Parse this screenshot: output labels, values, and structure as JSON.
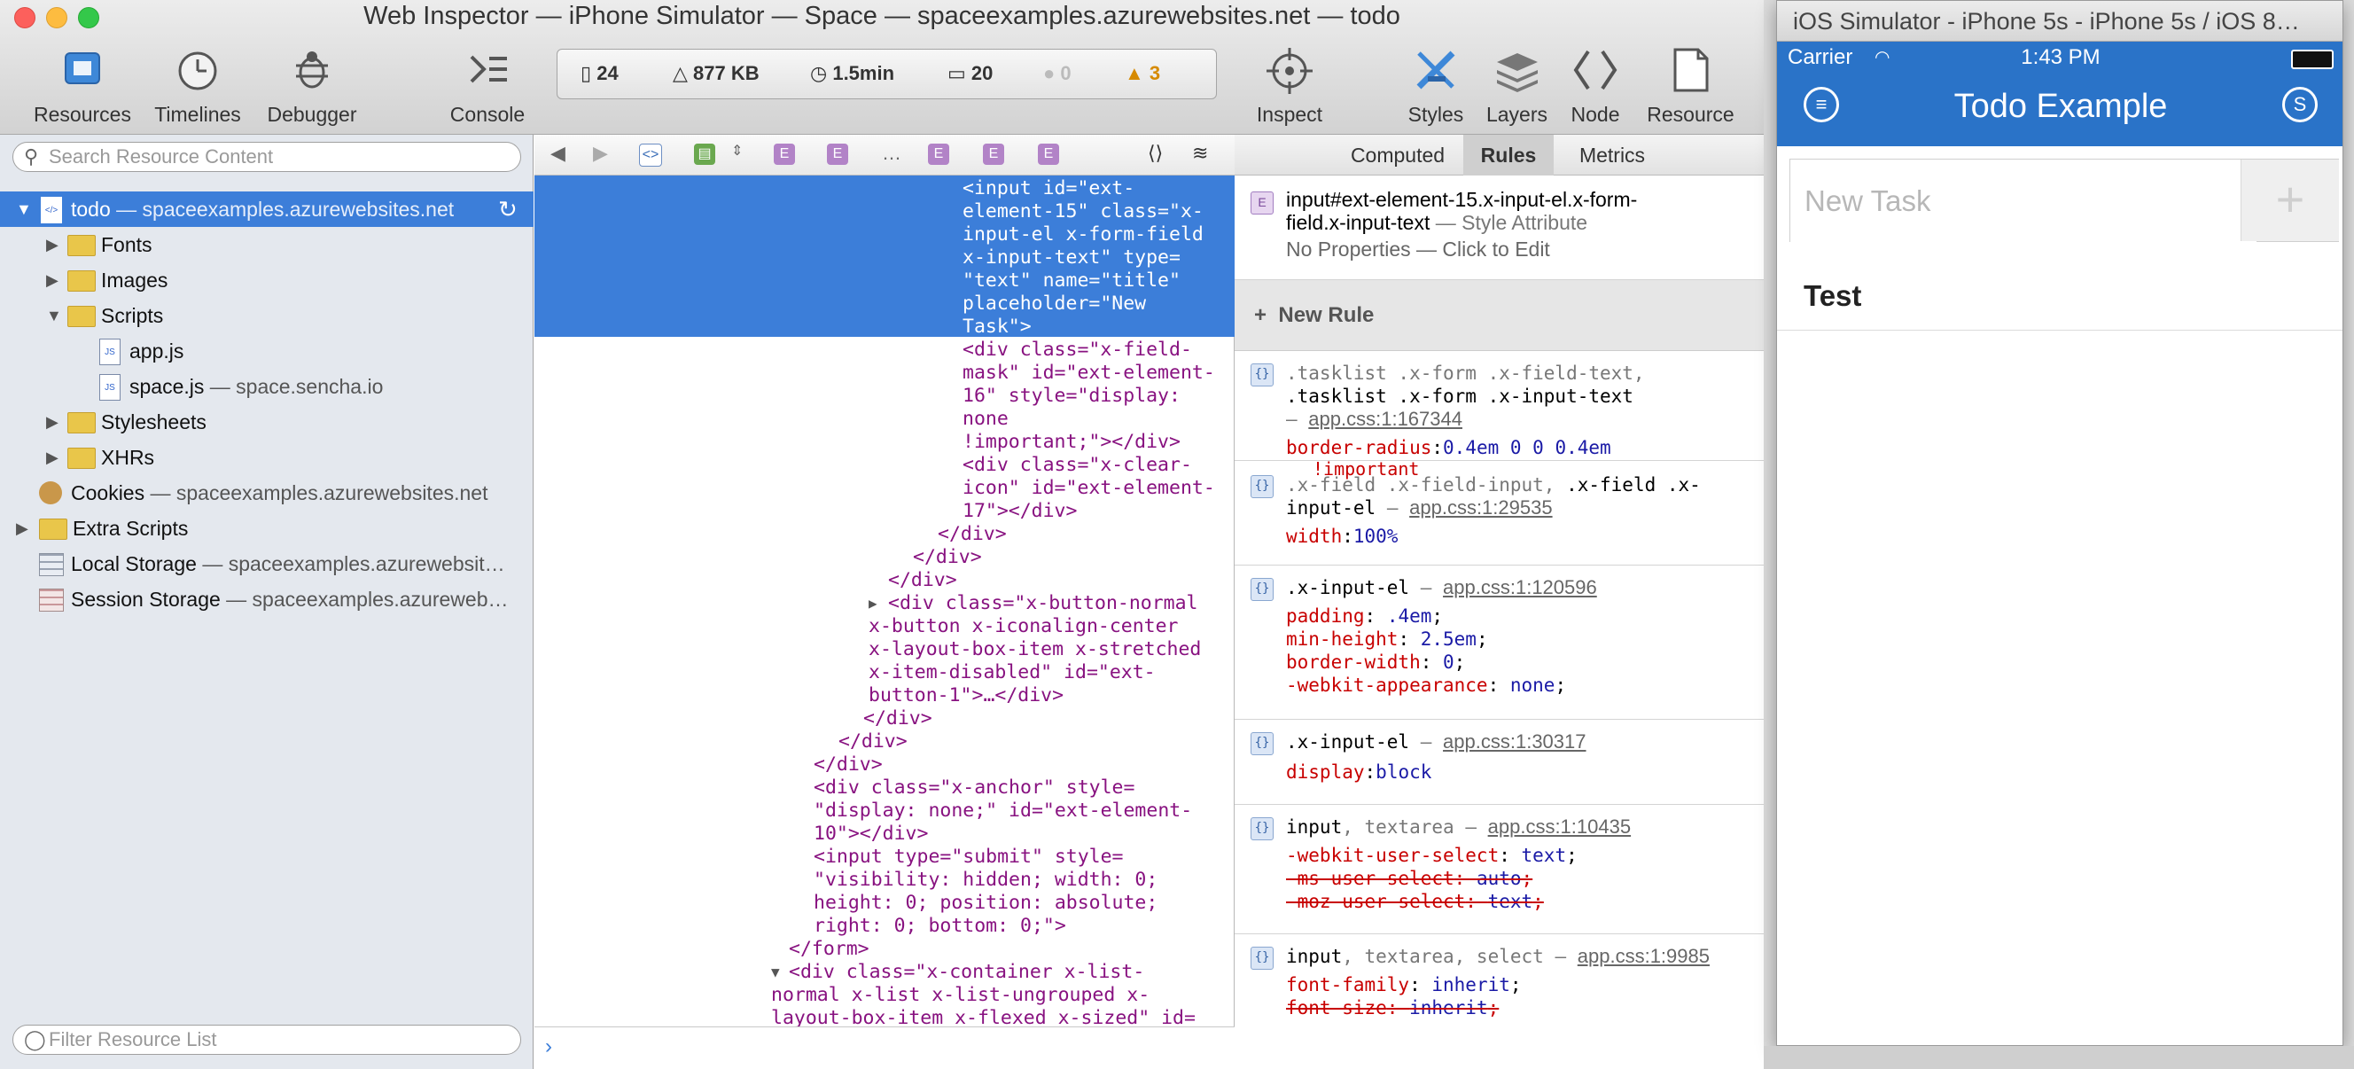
{
  "inspector": {
    "title": "Web Inspector — iPhone Simulator — Space — spaceexamples.azurewebsites.net — todo",
    "toolbar_left": [
      {
        "label": "Resources",
        "icon": "resources-icon"
      },
      {
        "label": "Timelines",
        "icon": "timelines-icon"
      },
      {
        "label": "Debugger",
        "icon": "debugger-icon"
      },
      {
        "label": "Console",
        "icon": "console-icon"
      }
    ],
    "activity": {
      "resources": "24",
      "size": "877 KB",
      "time": "1.5min",
      "logs": "20",
      "errors": "0",
      "warnings": "3"
    },
    "toolbar_right": [
      {
        "label": "Inspect",
        "icon": "inspect-icon"
      },
      {
        "label": "Styles",
        "icon": "styles-icon"
      },
      {
        "label": "Layers",
        "icon": "layers-icon"
      },
      {
        "label": "Node",
        "icon": "node-icon"
      },
      {
        "label": "Resource",
        "icon": "resource-icon"
      }
    ]
  },
  "sidebar": {
    "search_placeholder": "Search Resource Content",
    "filter_placeholder": "Filter Resource List",
    "root": {
      "name": "todo",
      "host": "— spaceexamples.azurewebsites.net"
    },
    "folders": [
      "Fonts",
      "Images",
      "Scripts"
    ],
    "scripts": [
      {
        "name": "app.js",
        "host": ""
      },
      {
        "name": "space.js",
        "host": "— space.sencha.io"
      }
    ],
    "more_folders": [
      "Stylesheets",
      "XHRs"
    ],
    "cookies": {
      "name": "Cookies",
      "host": "— spaceexamples.azurewebsites.net"
    },
    "extra": "Extra Scripts",
    "local_storage": {
      "name": "Local Storage",
      "host": "— spaceexamples.azurewebsit…"
    },
    "session_storage": {
      "name": "Session Storage",
      "host": "— spaceexamples.azureweb…"
    }
  },
  "dom": {
    "crumb_ellipsis": "…",
    "lines": [
      "<input id=\"ext-",
      "element-15\" class=\"x-",
      "input-el x-form-field",
      "x-input-text\" type=",
      "\"text\" name=\"title\"",
      "placeholder=\"New",
      "Task\">",
      "<div class=\"x-field-",
      "mask\" id=\"ext-element-",
      "16\" style=\"display:",
      "none",
      "!important;\"></div>",
      "<div class=\"x-clear-",
      "icon\" id=\"ext-element-",
      "17\"></div>",
      "</div>",
      "</div>",
      "</div>",
      "<div class=\"x-button-normal",
      "x-button x-iconalign-center",
      "x-layout-box-item x-stretched",
      "x-item-disabled\" id=\"ext-",
      "button-1\">…</div>",
      "</div>",
      "</div>",
      "</div>",
      "<div class=\"x-anchor\" style=",
      "\"display: none;\" id=\"ext-element-",
      "10\"></div>",
      "<input type=\"submit\" style=",
      "\"visibility: hidden; width: 0;",
      "height: 0; position: absolute;",
      "right: 0; bottom: 0;\">",
      "</form>",
      "<div class=\"x-container x-list-",
      "normal x-list x-list-ungrouped x-",
      "layout-box-item x-flexed x-sized\" id="
    ]
  },
  "rules": {
    "tabs": [
      "Computed",
      "Rules",
      "Metrics"
    ],
    "element_selector_1": "input#ext-element-15.x-input-el.x-form-",
    "element_selector_2": "field.x-input-text",
    "element_origin": "— Style Attribute",
    "no_props": "No Properties — Click to Edit",
    "new_rule": "New Rule",
    "r1_sel1a": ".tasklist .x-form .x-field-text,",
    "r1_sel2": ".tasklist .x-form .x-input-text",
    "r1_src": "app.css:1:167344",
    "r1_prop": "border-radius",
    "r1_val": "0.4em 0 0 0.4em",
    "r1_imp": "!important",
    "r2_sel1a": ".x-field .x-field-input,",
    "r2_sel1b": ".x-field .x-",
    "r2_sel2": "input-el",
    "r2_src": "app.css:1:29535",
    "r2_prop": "width",
    "r2_val": "100%",
    "r3_sel": ".x-input-el",
    "r3_src": "app.css:1:120596",
    "r3_props": [
      {
        "p": "padding",
        "v": ".4em"
      },
      {
        "p": "min-height",
        "v": "2.5em"
      },
      {
        "p": "border-width",
        "v": "0"
      },
      {
        "p": "-webkit-appearance",
        "v": "none"
      }
    ],
    "r4_sel": ".x-input-el",
    "r4_src": "app.css:1:30317",
    "r4_prop": "display",
    "r4_val": "block",
    "r5_sel_a": "input",
    "r5_sel_b": ", textarea",
    "r5_src": "app.css:1:10435",
    "r5_props": [
      {
        "p": "-webkit-user-select",
        "v": "text"
      },
      {
        "p": "-ms-user-select",
        "v": "auto"
      },
      {
        "p": "-moz-user-select",
        "v": "text"
      }
    ],
    "r6_sel_a": "input",
    "r6_sel_b": ", textarea, select",
    "r6_src": "app.css:1:9985",
    "r6_prop": "font-family",
    "r6_val": "inherit",
    "r6_prop2": "font-size",
    "r6_val2": "inherit"
  },
  "simulator": {
    "title": "iOS Simulator - iPhone 5s - iPhone 5s / iOS 8…",
    "carrier": "Carrier",
    "time": "1:43 PM",
    "app_title": "Todo Example",
    "task_placeholder": "New Task",
    "add_label": "+",
    "items": [
      "Test"
    ]
  },
  "colors": {
    "accent": "#2a73c8",
    "selection": "#3c7ed9",
    "tag": "#881280",
    "attr": "#994500",
    "value": "#1a1aa6",
    "prop": "#c80000"
  }
}
